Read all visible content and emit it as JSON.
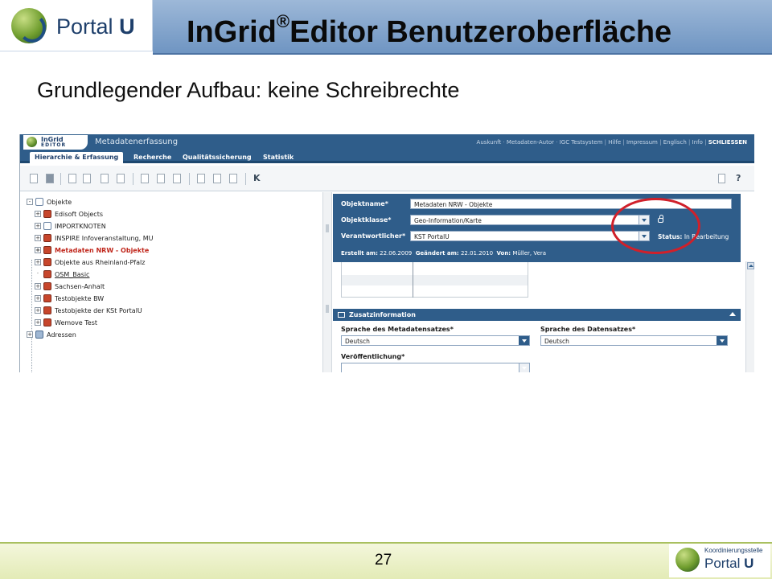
{
  "slide": {
    "title_main": "InGrid",
    "title_reg": "®",
    "title_rest": "Editor Benutzeroberfläche",
    "subtitle": "Grundlegender Aufbau: keine Schreibrechte",
    "page_number": "27",
    "logo_word": "Portal",
    "logo_word_bold": "U",
    "footer_logo_caption": "Koordinierungsstelle",
    "footer_logo_word": "Portal",
    "footer_logo_word_bold": "U"
  },
  "app": {
    "logo_line1": "InGrid",
    "logo_line2": "EDITOR",
    "module_title": "Metadatenerfassung",
    "top_links": [
      "Auskunft",
      "Metadaten-Autor",
      "IGC Testsystem",
      "Hilfe",
      "Impressum",
      "Englisch",
      "Info"
    ],
    "top_links_close": "SCHLIESSEN",
    "tabs": [
      "Hierarchie & Erfassung",
      "Recherche",
      "Qualitätssicherung",
      "Statistik"
    ],
    "toolbar_help": "?",
    "tree": {
      "root": "Objekte",
      "items": [
        "Edisoft Objects",
        "IMPORTKNOTEN",
        "INSPIRE Infoveranstaltung, MU",
        "Metadaten NRW - Objekte",
        "Objekte aus Rheinland-Pfalz",
        "OSM_Basic",
        "Sachsen-Anhalt",
        "Testobjekte BW",
        "Testobjekte der KSt PortalU",
        "Wemove Test"
      ],
      "addresses": "Adressen"
    },
    "object": {
      "name_label": "Objektname*",
      "name_value": "Metadaten NRW - Objekte",
      "class_label": "Objektklasse*",
      "class_value": "Geo-Information/Karte",
      "owner_label": "Verantwortlicher*",
      "owner_value": "KST PortalU",
      "status_label": "Status:",
      "status_value": "In Bearbeitung",
      "created_label": "Erstellt am:",
      "created_value": "22.06.2009",
      "changed_label": "Geändert am:",
      "changed_value": "22.01.2010",
      "by_label": "Von:",
      "by_value": "Müller, Vera"
    },
    "section": {
      "title": "Zusatzinformation",
      "meta_lang_label": "Sprache des Metadatensatzes*",
      "meta_lang_value": "Deutsch",
      "data_lang_label": "Sprache des Datensatzes*",
      "data_lang_value": "Deutsch",
      "publication_label": "Veröffentlichung*"
    }
  },
  "colors": {
    "app_blue": "#2f5d8a",
    "annotation_red": "#d0202a",
    "active_tree_item": "#c0271c"
  }
}
